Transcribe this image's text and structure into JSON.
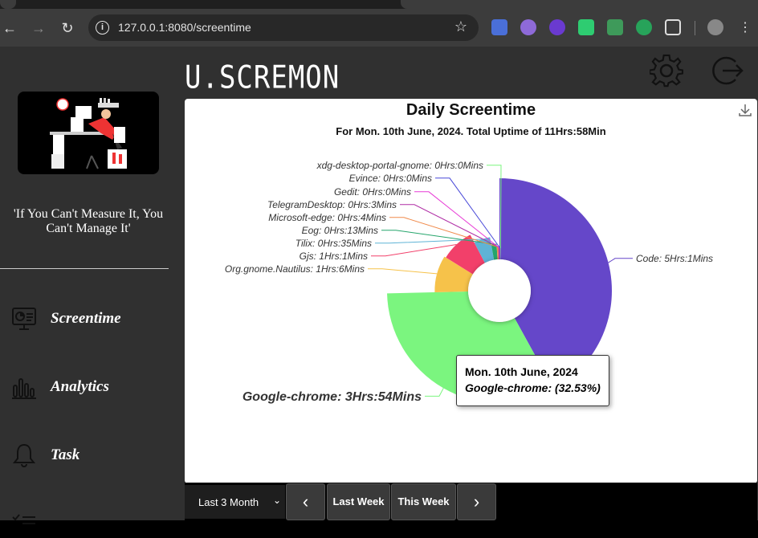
{
  "browser": {
    "url": "127.0.0.1:8080/screentime"
  },
  "app": {
    "logo_text": "U.SCREMON",
    "quote": "'If You Can't Measure It, You Can't Manage It'",
    "nav": [
      {
        "label": "Screentime",
        "icon": "monitor-chart-icon"
      },
      {
        "label": "Analytics",
        "icon": "bar-chart-icon"
      },
      {
        "label": "Task",
        "icon": "bell-icon"
      },
      {
        "label": "",
        "icon": "checklist-icon"
      }
    ]
  },
  "chart_data": {
    "type": "pie",
    "title": "Daily Screentime",
    "subtitle": "For Mon. 10th June, 2024. Total Uptime of 11Hrs:58Min",
    "series": [
      {
        "name": "Code",
        "value_label": "Code: 5Hrs:1Mins",
        "minutes": 301,
        "color": "#6547c9"
      },
      {
        "name": "Google-chrome",
        "value_label": "Google-chrome: 3Hrs:54Mins",
        "minutes": 234,
        "color": "#7bf57f"
      },
      {
        "name": "Org.gnome.Nautilus",
        "value_label": "Org.gnome.Nautilus: 1Hrs:6Mins",
        "minutes": 66,
        "color": "#f6c24a"
      },
      {
        "name": "Gjs",
        "value_label": "Gjs: 1Hrs:1Mins",
        "minutes": 61,
        "color": "#f2406a"
      },
      {
        "name": "Tilix",
        "value_label": "Tilix: 0Hrs:35Mins",
        "minutes": 35,
        "color": "#5fb3d6"
      },
      {
        "name": "Eog",
        "value_label": "Eog: 0Hrs:13Mins",
        "minutes": 13,
        "color": "#25a56b"
      },
      {
        "name": "Microsoft-edge",
        "value_label": "Microsoft-edge: 0Hrs:4Mins",
        "minutes": 4,
        "color": "#f08a4b"
      },
      {
        "name": "TelegramDesktop",
        "value_label": "TelegramDesktop: 0Hrs:3Mins",
        "minutes": 3,
        "color": "#b02fa6"
      },
      {
        "name": "Gedit",
        "value_label": "Gedit: 0Hrs:0Mins",
        "minutes": 0,
        "color": "#e83bd6"
      },
      {
        "name": "Evince",
        "value_label": "Evince: 0Hrs:0Mins",
        "minutes": 0,
        "color": "#4848d8"
      },
      {
        "name": "xdg-desktop-portal-gnome",
        "value_label": "xdg-desktop-portal-gnome: 0Hrs:0Mins",
        "minutes": 0,
        "color": "#7bf57f"
      }
    ],
    "tooltip": {
      "title": "Mon. 10th June, 2024",
      "body": "Google-chrome: (32.53%)"
    }
  },
  "controls": {
    "range": "Last 3 Month",
    "prev": "‹",
    "last_week": "Last Week",
    "this_week": "This Week",
    "next": "›"
  }
}
